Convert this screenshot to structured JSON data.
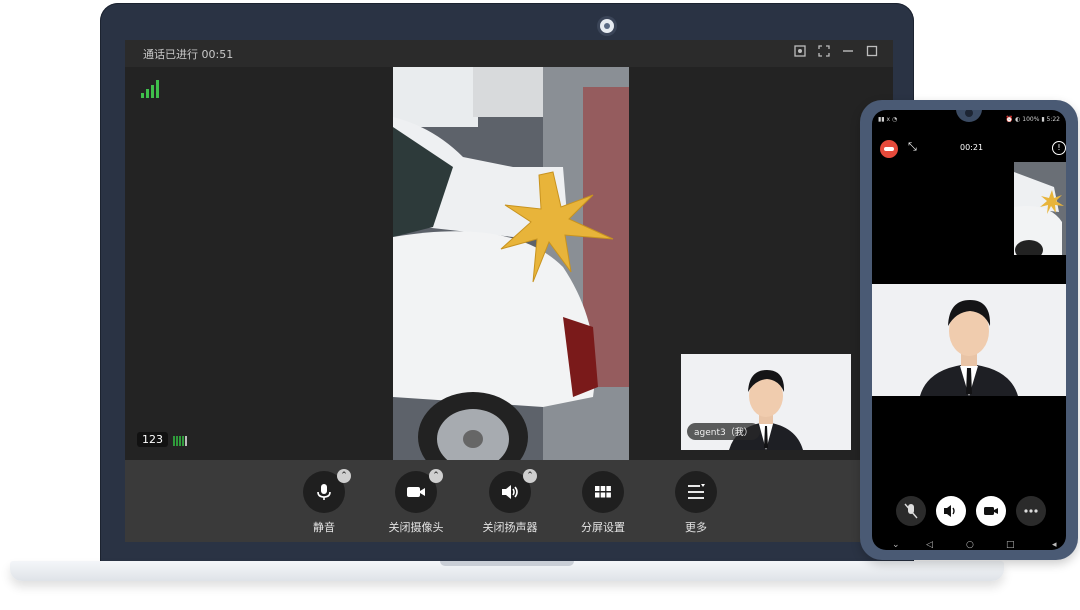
{
  "call": {
    "status": "通话已进行 00:51"
  },
  "window_controls": [
    "screenshot-icon",
    "fullscreen-icon",
    "minimize-icon",
    "maximize-icon"
  ],
  "local_video": {
    "label": "agent3（我）"
  },
  "audio_meter": {
    "value": "123"
  },
  "toolbar": {
    "mute": "静音",
    "camera_off": "关闭摄像头",
    "speaker_off": "关闭扬声器",
    "split_screen": "分屏设置",
    "more": "更多"
  },
  "phone": {
    "status_left": "▮▮ ⅹ ◔",
    "status_right": "⏰ ◐ 100% ▮ 5:22",
    "timer": "00:21",
    "info": "!"
  },
  "colors": {
    "signal_green": "#3fbf4b",
    "hangup_red": "#e64a3b",
    "lid": "#2a3344",
    "toolbar_bg": "#3a3a3a"
  }
}
